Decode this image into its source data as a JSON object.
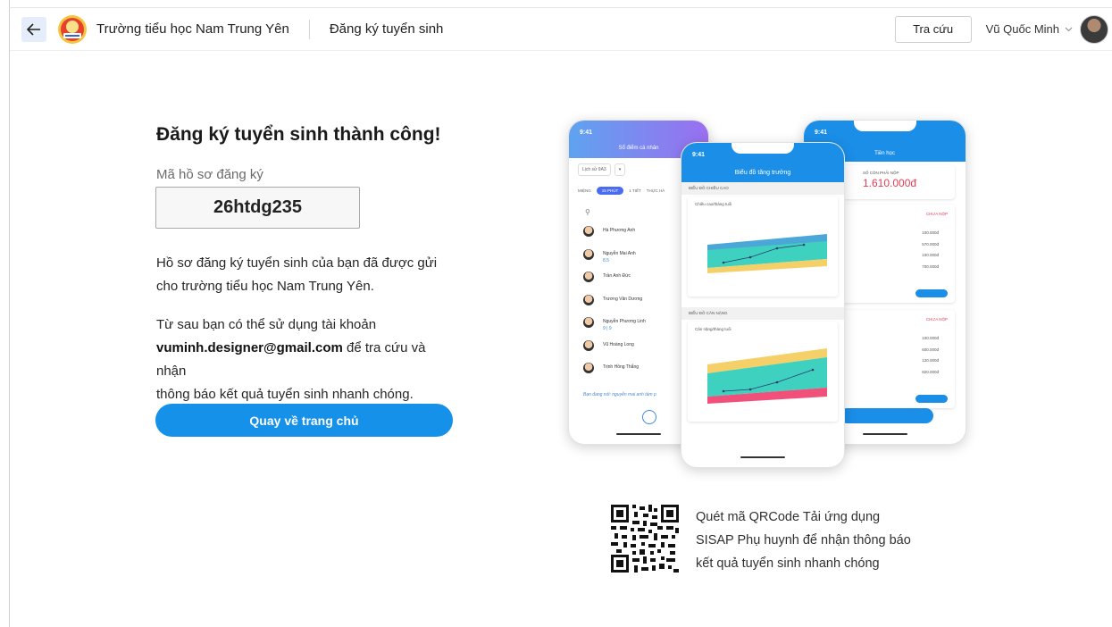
{
  "header": {
    "school_name": "Trường tiểu học Nam Trung Yên",
    "page_name": "Đăng ký tuyển sinh",
    "lookup_label": "Tra cứu",
    "user_name": "Vũ Quốc Minh"
  },
  "main": {
    "title": "Đăng ký tuyển sinh thành công!",
    "code_label": "Mã hồ sơ đăng ký",
    "code_value": "26htdg235",
    "para1_line1": "Hồ sơ đăng ký tuyển sinh của bạn đã được gửi",
    "para1_line2": "cho trường tiểu học Nam Trung Yên.",
    "para2_line1": "Từ sau bạn có thể sử dụng tài khoản",
    "para2_email": "vuminh.designer@gmail.com",
    "para2_rest": " để tra cứu và nhận",
    "para2_line3": "thông báo kết quả tuyển sinh nhanh chóng.",
    "home_button": "Quay về trang chủ"
  },
  "phones": {
    "time": "9:41",
    "a": {
      "title": "Sổ điểm cá nhân",
      "filter1": "Lịch sử 9A3",
      "tabs": [
        "MIỆNG",
        "15 PHÚT",
        "1 TIẾT",
        "THỰC HÀ"
      ],
      "students": [
        {
          "name": "Hà Phương Anh",
          "score": ""
        },
        {
          "name": "Nguyễn Mai Anh",
          "score": "8.5"
        },
        {
          "name": "Trần Anh Đức",
          "score": ""
        },
        {
          "name": "Trương Văn Dương",
          "score": ""
        },
        {
          "name": "Nguyễn Phương Linh",
          "score": "9 | 9"
        },
        {
          "name": "Vũ Hoàng Long",
          "score": ""
        },
        {
          "name": "Trịnh Hồng Thắng",
          "score": ""
        }
      ],
      "voice_note": "Bạn đang nói: nguyễn mai anh tám p"
    },
    "b": {
      "title": "Biểu đồ tăng trưởng",
      "section1": "BIỂU ĐỒ CHIỀU CAO",
      "chart1_title": "Chiều cao/tháng tuổi",
      "section2": "BIỂU ĐỒ CÂN NẶNG",
      "chart2_title": "Cân nặng/tháng tuổi"
    },
    "c": {
      "title": "Tiền học",
      "fee_label": "SỐ CÒN PHẢI NỘP",
      "fee_value": "1.610.000đ",
      "status1": "CHƯA NỘP",
      "rows1": [
        "100.000đ",
        "570.000đ",
        "100.000đ",
        "700.000đ"
      ],
      "status2": "CHƯA NỘP",
      "rows2": [
        "100.000đ",
        "600.000đ",
        "120.000đ",
        "820.000đ"
      ],
      "submit": "Nộp tiền"
    }
  },
  "qr": {
    "line1": "Quét mã QRCode Tải ứng dụng",
    "line2": "SISAP Phụ huynh để nhận thông báo",
    "line3": "kết quả tuyển sinh nhanh chóng"
  },
  "colors": {
    "primary": "#1591ea",
    "back_bg": "#e4edf9",
    "danger": "#e33b53"
  }
}
